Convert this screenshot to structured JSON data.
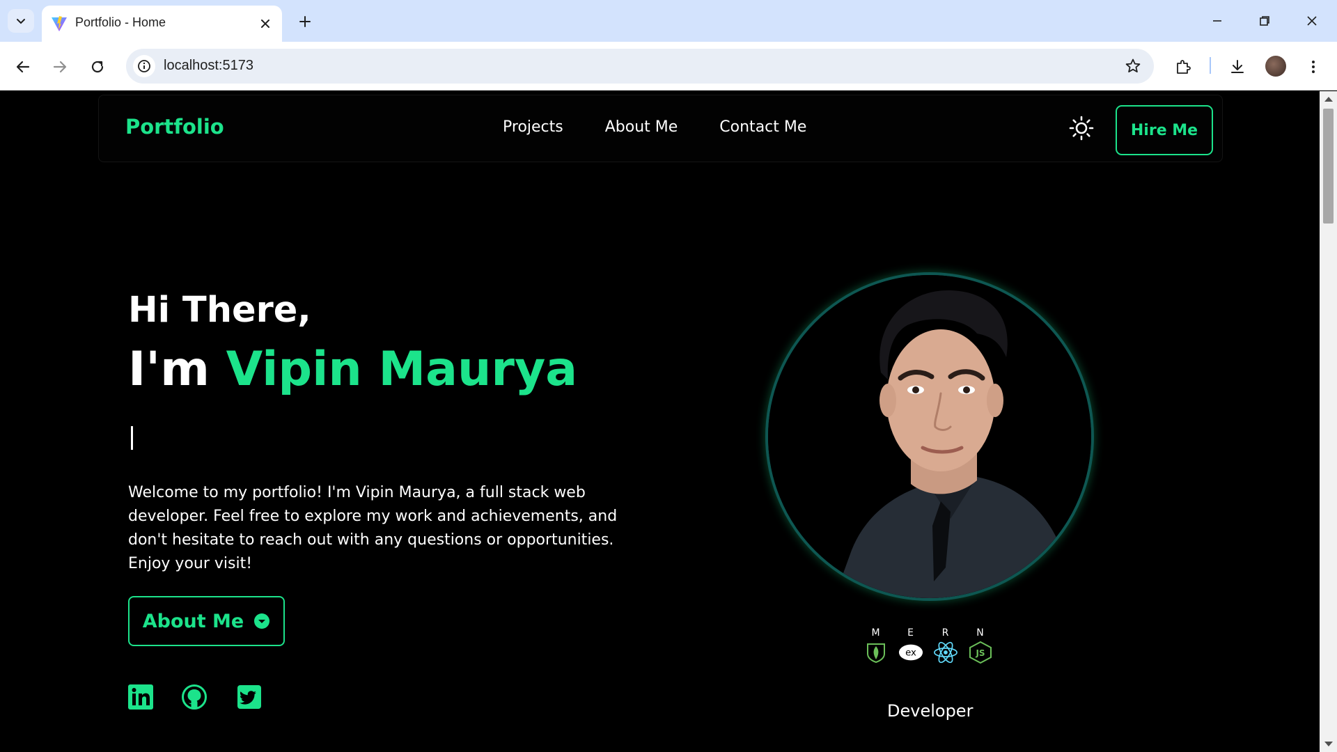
{
  "browser": {
    "tab_title": "Portfolio - Home",
    "url": "localhost:5173"
  },
  "site": {
    "brand": "Portfolio",
    "nav": [
      "Projects",
      "About Me",
      "Contact Me"
    ],
    "hire_button": "Hire Me",
    "theme_icon": "sun-icon"
  },
  "hero": {
    "greeting": "Hi There,",
    "name_prefix": "I'm ",
    "name": "Vipin Maurya",
    "description": "Welcome to my portfolio! I'm Vipin Maurya, a full stack web developer. Feel free to explore my work and achievements, and don't hesitate to reach out with any questions or opportunities. Enjoy your visit!",
    "about_button": "About Me",
    "social_icons": [
      "linkedin-icon",
      "github-icon",
      "twitter-icon"
    ]
  },
  "profile": {
    "stack": [
      {
        "letter": "M",
        "icon": "mongodb-icon"
      },
      {
        "letter": "E",
        "icon": "express-icon",
        "text": "ex"
      },
      {
        "letter": "R",
        "icon": "react-icon"
      },
      {
        "letter": "N",
        "icon": "nodejs-icon",
        "text": "JS"
      }
    ],
    "role": "Developer"
  },
  "colors": {
    "accent": "#1ce38b",
    "background": "#000000",
    "ring": "#0e5752"
  }
}
